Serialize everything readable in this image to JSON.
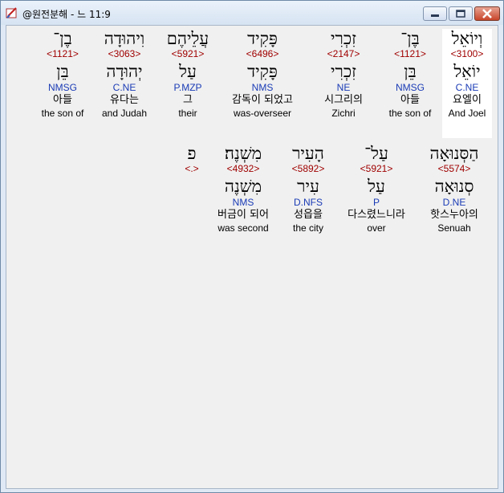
{
  "window": {
    "title": "@원전분해 - 느 11:9",
    "controls": {
      "minimize_icon": "minimize-icon",
      "maximize_icon": "maximize-icon",
      "close_icon": "close-icon"
    }
  },
  "line1": [
    {
      "hebrew": "וְיוֹאֵל",
      "strong": "<3100>",
      "lexeme": "יוֹאֵל",
      "morph": "C.NE",
      "korean": "요엘이",
      "english": "And Joel",
      "selected": true
    },
    {
      "hebrew": "בֶּן־",
      "strong": "<1121>",
      "lexeme": "בֵּן",
      "morph": "NMSG",
      "korean": "아들",
      "english": "the son of"
    },
    {
      "hebrew": "זִכְרִי",
      "strong": "<2147>",
      "lexeme": "זִכְרִי",
      "morph": "NE",
      "korean": "시그리의",
      "english": "Zichri"
    },
    {
      "hebrew": "פָּקִיד",
      "strong": "<6496>",
      "lexeme": "פָּקִיד",
      "morph": "NMS",
      "korean": "감독이 되었고",
      "english": "was-overseer"
    },
    {
      "hebrew": "עֲלֵיהֶם",
      "strong": "<5921>",
      "lexeme": "עַל",
      "morph": "P.MZP",
      "korean": "그",
      "english": "their"
    },
    {
      "hebrew": "וִיהוּדָה",
      "strong": "<3063>",
      "lexeme": "יְהוּדָה",
      "morph": "C.NE",
      "korean": "유다는",
      "english": "and Judah"
    },
    {
      "hebrew": "בֶן־",
      "strong": "<1121>",
      "lexeme": "בֵּן",
      "morph": "NMSG",
      "korean": "아들",
      "english": "the son of"
    }
  ],
  "line2": [
    {
      "hebrew": "הַסְּנוּאָה",
      "strong": "<5574>",
      "lexeme": "סְנוּאָה",
      "morph": "D.NE",
      "korean": "핫스누아의",
      "english": "Senuah"
    },
    {
      "hebrew": "עַל־",
      "strong": "<5921>",
      "lexeme": "עַל",
      "morph": "P",
      "korean": "다스렸느니라",
      "english": "over"
    },
    {
      "hebrew": "הָעִיר",
      "strong": "<5892>",
      "lexeme": "עִיר",
      "morph": "D.NFS",
      "korean": "성읍을",
      "english": "the city"
    },
    {
      "hebrew": "מִשְׁנֶה׃",
      "strong": "<4932>",
      "lexeme": "מִשְׁנֶה",
      "morph": "NMS",
      "korean": "버금이 되어",
      "english": "was second"
    },
    {
      "hebrew": "פ",
      "strong": "<.>",
      "lexeme": "",
      "morph": "",
      "korean": "",
      "english": ""
    }
  ]
}
